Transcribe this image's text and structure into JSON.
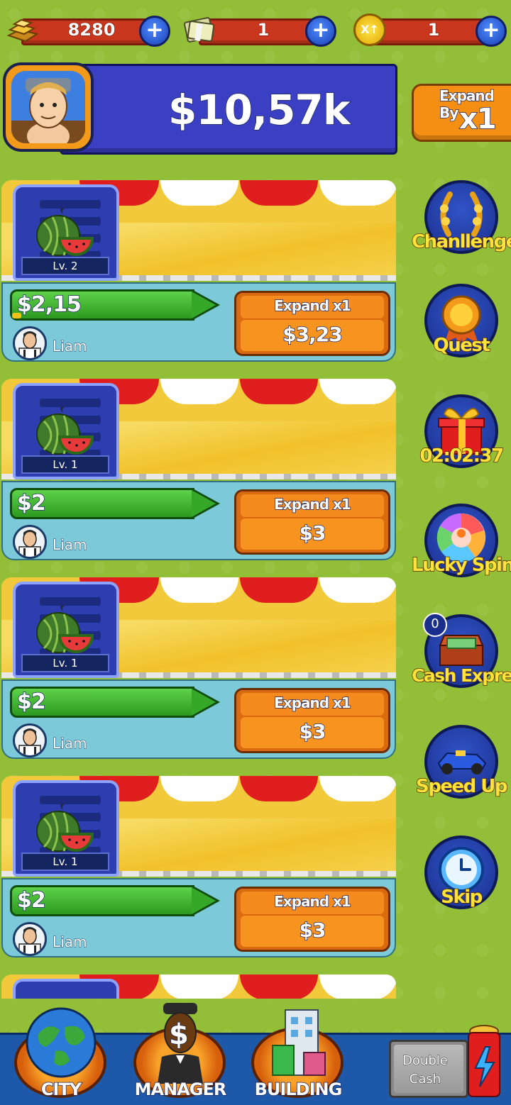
{
  "currency": {
    "gold": "8280",
    "cash_bills": "1",
    "multiplier": "1",
    "multiplier_icon_text": "X↑"
  },
  "header": {
    "total_cash": "$10,57k",
    "expand_by_label": "Expand By",
    "expand_by_value": "x1"
  },
  "shops": [
    {
      "level": "Lv. 2",
      "income": "$2,15",
      "manager": "Liam",
      "expand_label": "Expand x1",
      "expand_cost": "$3,23",
      "progress": 0.05
    },
    {
      "level": "Lv. 1",
      "income": "$2",
      "manager": "Liam",
      "expand_label": "Expand x1",
      "expand_cost": "$3",
      "progress": 0
    },
    {
      "level": "Lv. 1",
      "income": "$2",
      "manager": "Liam",
      "expand_label": "Expand x1",
      "expand_cost": "$3",
      "progress": 0
    },
    {
      "level": "Lv. 1",
      "income": "$2",
      "manager": "Liam",
      "expand_label": "Expand x1",
      "expand_cost": "$3",
      "progress": 0
    }
  ],
  "side_buttons": {
    "challenges": "Chanllenges",
    "quest": "Quest",
    "gift_timer": "02:02:37",
    "lucky_spin": "Lucky Spin",
    "cash_express": "Cash Express",
    "cash_express_badge": "0",
    "speed_up": "Speed Up",
    "skip": "Skip"
  },
  "bottom_nav": {
    "city": "CITY",
    "manager": "MANAGER",
    "building": "BUILDING",
    "double_cash_line1": "Double",
    "double_cash_line2": "Cash",
    "manager_symbol": "$"
  },
  "colors": {
    "background": "#93be37",
    "header_panel": "#3b3fc4",
    "accent_orange": "#f58f14",
    "income_green": "#2a9a1d",
    "side_label_yellow": "#ffe23a"
  },
  "icons": {
    "gold": "gold-bars-icon",
    "cash": "cash-stack-icon",
    "multiplier": "multiplier-coin-icon",
    "challenges": "laurel-wreath-icon",
    "quest": "medal-ribbon-icon",
    "gift": "gift-box-icon",
    "spin": "prize-wheel-icon",
    "cash_express": "money-chest-icon",
    "speed_up": "race-car-icon",
    "skip": "clock-icon"
  }
}
